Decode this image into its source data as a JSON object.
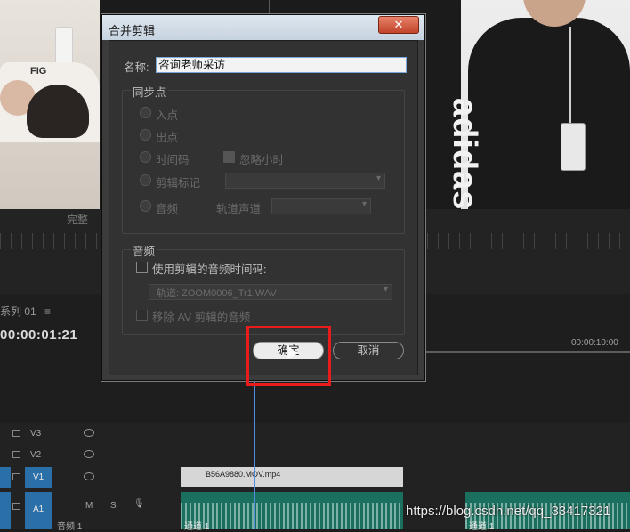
{
  "background": {
    "left_frame_text": "FIG",
    "right_frame_brand": "adidas",
    "status_left": "完整",
    "sequence_name": "系列 01",
    "sequence_menu_icon": "hamburger-icon",
    "timecode": "00:00:01:21",
    "timecode_right": "00:00:10:00",
    "tracks": [
      {
        "name": "V3"
      },
      {
        "name": "V2"
      },
      {
        "name": "V1",
        "target": "V1"
      },
      {
        "name": "A1",
        "target": "A1",
        "m": "M",
        "s": "S",
        "label": "音频 1"
      }
    ],
    "clip_video": "B56A9880.MOV.mp4",
    "clip_audio_label": "通道 1",
    "watermark": "https://blog.csdn.net/qq_33417321"
  },
  "dialog": {
    "title": "合并剪辑",
    "close_glyph": "✕",
    "name_label": "名称:",
    "name_value": "咨询老师采访",
    "sync_group": {
      "legend": "同步点",
      "options": [
        "入点",
        "出点",
        "时间码",
        "剪辑标记",
        "音频"
      ],
      "ignore_hours": "忽略小时",
      "track_channel": "轨道声道"
    },
    "audio_group": {
      "legend": "音频",
      "use_clip_timecode": "使用剪辑的音频时间码:",
      "track_dropdown": "轨道: ZOOM0006_Tr1.WAV",
      "remove_av_audio": "移除 AV 剪辑的音频"
    },
    "ok_label": "确定",
    "cancel_label": "取消"
  },
  "colors": {
    "highlight_box": "#e81c1c",
    "track_target": "#2a6fa8",
    "audio_clip": "#1b6f5e",
    "playhead": "#4f8de0"
  }
}
